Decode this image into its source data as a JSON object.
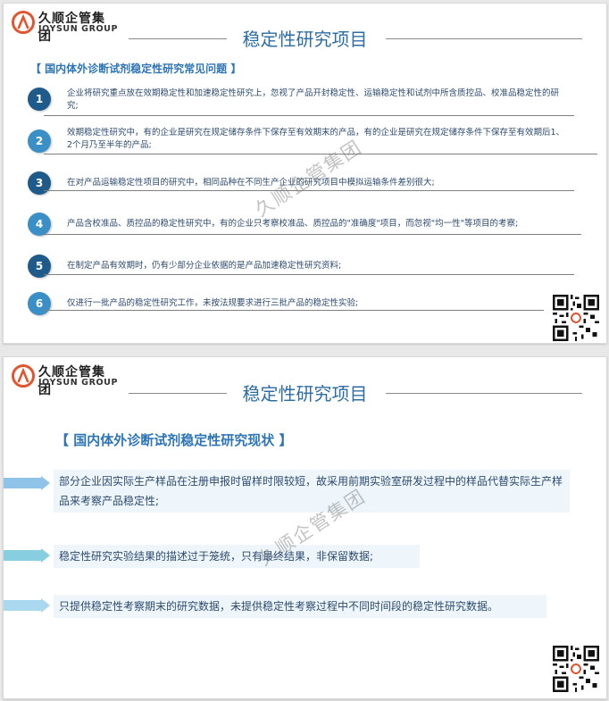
{
  "brand": {
    "name_cn": "久顺企管集团",
    "name_en": "JOYSUN GROUP"
  },
  "watermark": "久顺企管集团",
  "slide1": {
    "title": "稳定性研究项目",
    "section_heading": "【 国内体外诊断试剂稳定性研究常见问题 】",
    "items": [
      {
        "num": "1",
        "text": "企业将研究重点放在效期稳定性和加速稳定性研究上，忽视了产品开封稳定性、运输稳定性和试剂中所含质控品、校准品稳定性的研究;"
      },
      {
        "num": "2",
        "text": "效期稳定性研究中，有的企业是研究在规定储存条件下保存至有效期末的产品，有的企业是研究在规定储存条件下保存至有效期后1、2个月乃至半年的产品;"
      },
      {
        "num": "3",
        "text": "在对产品运输稳定性项目的研究中，相同品种在不同生产企业的研究项目中模拟运输条件差别很大;"
      },
      {
        "num": "4",
        "text": "产品含校准品、质控品的稳定性研究中，有的企业只考察校准品、质控品的\"准确度\"项目，而忽视\"均一性\"等项目的考察;"
      },
      {
        "num": "5",
        "text": "在制定产品有效期时，仍有少部分企业依据的是产品加速稳定性研究资料;"
      },
      {
        "num": "6",
        "text": "仅进行一批产品的稳定性研究工作，未按法规要求进行三批产品的稳定性实验;"
      }
    ]
  },
  "slide2": {
    "title": "稳定性研究项目",
    "section_heading": "【 国内体外诊断试剂稳定性研究现状 】",
    "items": [
      {
        "text": "部分企业因实际生产样品在注册申报时留样时限较短，故采用前期实验室研发过程中的样品代替实际生产样品来考察产品稳定性;"
      },
      {
        "text": "稳定性研究实验结果的描述过于笼统，只有最终结果，非保留数据;"
      },
      {
        "text": "只提供稳定性考察期末的研究数据，未提供稳定性考察过程中不同时间段的稳定性研究数据。"
      }
    ]
  },
  "colors": {
    "title": "#2e6da4",
    "heading": "#2e75b6",
    "logo_red": "#e0562f",
    "badges": [
      "#1e5a8a",
      "#3b8fc7",
      "#1e5a8a",
      "#3b8fc7",
      "#1e5a8a",
      "#3b8fc7"
    ],
    "arrows": [
      "#8fc4e8",
      "#87cfe0",
      "#a9d8ef"
    ]
  },
  "icons": [
    "logo-mark",
    "qr-code"
  ]
}
